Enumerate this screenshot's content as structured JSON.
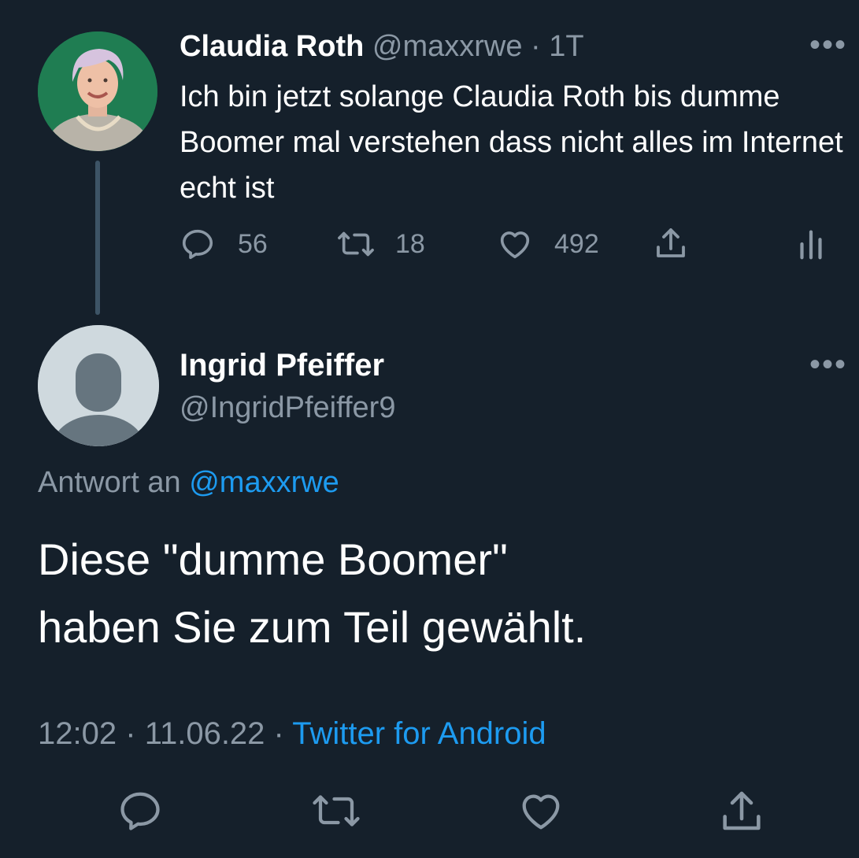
{
  "parent_tweet": {
    "display_name": "Claudia Roth",
    "handle": "@maxxrwe",
    "separator": "·",
    "time_ago": "1T",
    "text": "Ich bin jetzt solange Claudia Roth bis dumme Boomer mal verstehen dass nicht alles im Internet echt ist",
    "replies": "56",
    "retweets": "18",
    "likes": "492",
    "more": "•••"
  },
  "reply_tweet": {
    "display_name": "Ingrid Pfeiffer",
    "handle": "@IngridPfeiffer9",
    "more": "•••",
    "reply_to_prefix": "Antwort an",
    "reply_to_handle": "@maxxrwe",
    "text_line1": "Diese \"dumme Boomer\"",
    "text_line2": "haben Sie zum Teil gewählt.",
    "time": "12:02",
    "separator": "·",
    "date": "11.06.22",
    "source": "Twitter for Android"
  },
  "icons": {
    "reply": "reply-icon",
    "retweet": "retweet-icon",
    "like": "heart-icon",
    "share": "share-icon",
    "analytics": "analytics-icon"
  },
  "colors": {
    "background": "#15202b",
    "text": "#ffffff",
    "muted": "#8b98a5",
    "link": "#1d9bf0"
  }
}
